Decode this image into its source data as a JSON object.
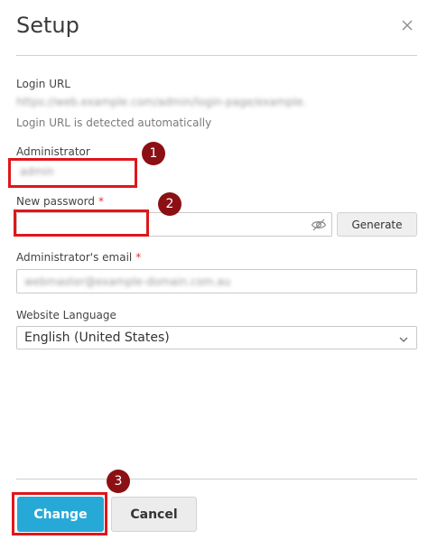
{
  "dialog": {
    "title": "Setup",
    "close_icon": "close-icon"
  },
  "login_url": {
    "label": "Login URL",
    "value": "https://web.example.com/admin/login-page/example.",
    "hint": "Login URL is detected automatically"
  },
  "administrator": {
    "label": "Administrator",
    "value": "admin"
  },
  "password": {
    "label": "New password",
    "required_mark": "*",
    "value": "",
    "visibility_icon": "eye-slash-icon",
    "generate_label": "Generate"
  },
  "email": {
    "label": "Administrator's email",
    "required_mark": "*",
    "value": "webmaster@example-domain.com.au"
  },
  "language": {
    "label": "Website Language",
    "selected": "English (United States)",
    "dropdown_icon": "chevron-down-icon"
  },
  "footer": {
    "change_label": "Change",
    "cancel_label": "Cancel"
  },
  "markers": [
    "1",
    "2",
    "3"
  ],
  "colors": {
    "accent": "#27a9d8",
    "highlight": "#e0161b",
    "marker": "#8b1014",
    "required": "#e0363b"
  }
}
